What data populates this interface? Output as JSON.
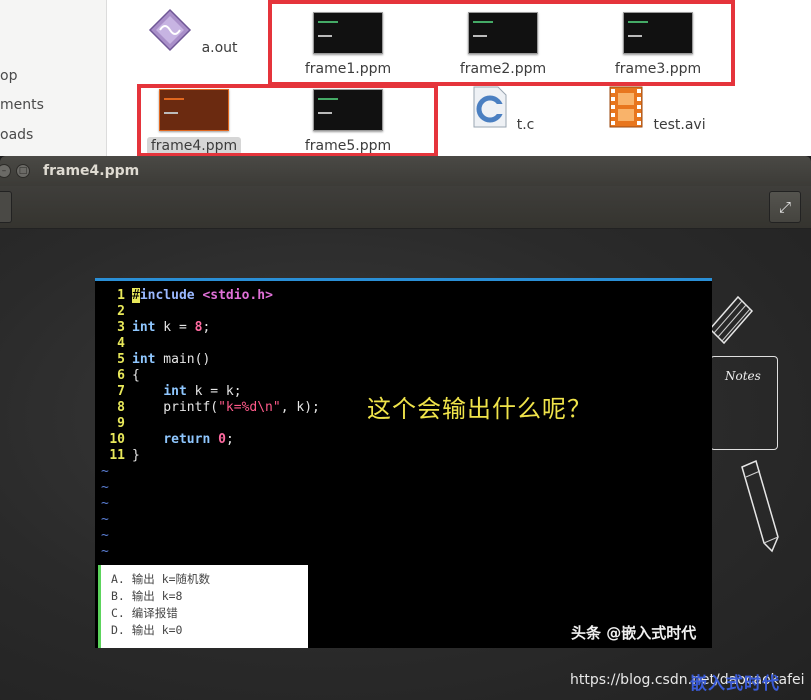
{
  "sidebar": {
    "items": [
      "op",
      "ments",
      "oads"
    ]
  },
  "files_row1": [
    {
      "name": "a.out",
      "icon": "executable-icon"
    },
    {
      "name": "frame1.ppm",
      "icon": "image-thumbnail"
    },
    {
      "name": "frame2.ppm",
      "icon": "image-thumbnail"
    },
    {
      "name": "frame3.ppm",
      "icon": "image-thumbnail"
    }
  ],
  "files_row2": [
    {
      "name": "frame4.ppm",
      "icon": "image-thumbnail",
      "selected": true
    },
    {
      "name": "frame5.ppm",
      "icon": "image-thumbnail"
    },
    {
      "name": "t.c",
      "icon": "c-source-icon"
    },
    {
      "name": "test.avi",
      "icon": "video-icon"
    }
  ],
  "viewer": {
    "title": "frame4.ppm",
    "fullscreen_icon": "fullscreen-icon"
  },
  "code": {
    "lines": [
      {
        "n": "1",
        "text": "#include <stdio.h>"
      },
      {
        "n": "2",
        "text": ""
      },
      {
        "n": "3",
        "text": "int k = 8;"
      },
      {
        "n": "4",
        "text": ""
      },
      {
        "n": "5",
        "text": "int main()"
      },
      {
        "n": "6",
        "text": "{"
      },
      {
        "n": "7",
        "text": "    int k = k;"
      },
      {
        "n": "8",
        "text": "    printf(\"k=%d\\n\", k);"
      },
      {
        "n": "9",
        "text": ""
      },
      {
        "n": "10",
        "text": "    return 0;"
      },
      {
        "n": "11",
        "text": "}"
      }
    ],
    "tilde": "~"
  },
  "question": "这个会输出什么呢？",
  "answers": [
    "A. 输出 k=随机数",
    "B. 输出 k=8",
    "C. 编译报错",
    "D. 输出 k=0"
  ],
  "watermark_toutiao": "头条 @嵌入式时代",
  "notes_label": "Notes",
  "url": "https://blog.csdn.net/daocaokafei",
  "watermark_corner": "嵌入式时代",
  "colors": {
    "highlight_box": "#e5343b",
    "accent": "#2a8fd6"
  }
}
